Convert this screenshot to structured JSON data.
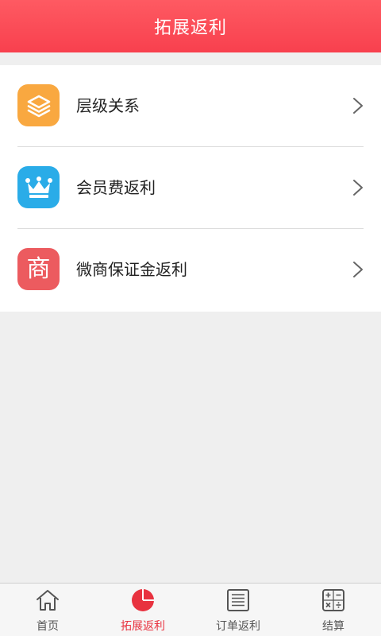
{
  "header": {
    "title": "拓展返利"
  },
  "colors": {
    "accent": "#f8404e",
    "icon_layers_bg": "#f9a840",
    "icon_crown_bg": "#2aace8",
    "icon_shop_bg": "#ec5b5f",
    "divider": "#dcdcdc"
  },
  "menu": {
    "items": [
      {
        "label": "层级关系",
        "icon": "layers-icon"
      },
      {
        "label": "会员费返利",
        "icon": "crown-icon"
      },
      {
        "label": "微商保证金返利",
        "icon": "shop-icon",
        "icon_text": "商"
      }
    ]
  },
  "tabbar": {
    "tabs": [
      {
        "label": "首页",
        "icon": "home-icon",
        "active": false
      },
      {
        "label": "拓展返利",
        "icon": "pie-chart-icon",
        "active": true
      },
      {
        "label": "订单返利",
        "icon": "list-icon",
        "active": false
      },
      {
        "label": "结算",
        "icon": "calculator-icon",
        "active": false
      }
    ]
  }
}
